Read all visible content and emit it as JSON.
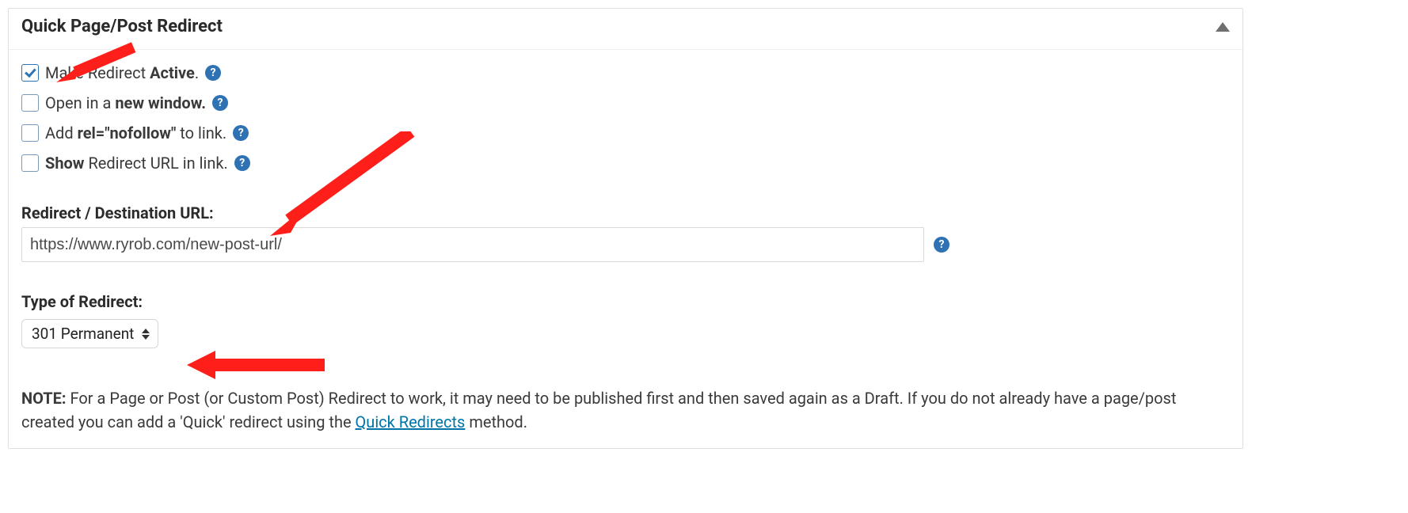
{
  "panel": {
    "title": "Quick Page/Post Redirect"
  },
  "options": {
    "active": {
      "pre": "Make Redirect ",
      "strong": "Active",
      "post": ".",
      "checked": true
    },
    "new_window": {
      "pre": "Open in a ",
      "strong": "new window.",
      "post": "",
      "checked": false
    },
    "nofollow": {
      "pre": "Add ",
      "strong": "rel=\"nofollow\"",
      "post": " to link.",
      "checked": false
    },
    "show_url": {
      "pre": "",
      "strong": "Show",
      "post": " Redirect URL in link.",
      "checked": false
    }
  },
  "url": {
    "label": "Redirect / Destination URL:",
    "value": "https://www.ryrob.com/new-post-url/"
  },
  "redirect_type": {
    "label": "Type of Redirect:",
    "selected": "301 Permanent"
  },
  "note": {
    "prefix": "NOTE:",
    "text_before_link": " For a Page or Post (or Custom Post) Redirect to work, it may need to be published first and then saved again as a Draft. If you do not already have a page/post created you can add a 'Quick' redirect using the ",
    "link_text": "Quick Redirects",
    "text_after_link": " method."
  },
  "help_glyph": "?"
}
